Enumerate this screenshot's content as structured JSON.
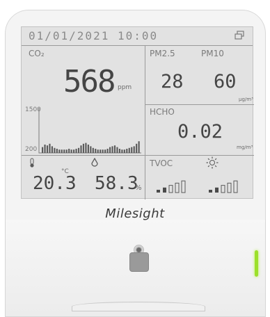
{
  "status_bar": {
    "datetime": "01/01/2021  10:00",
    "icon": "window-icon"
  },
  "co2": {
    "label": "CO₂",
    "value": "568",
    "unit": "ppm",
    "chart_max": "1500",
    "chart_min": "200",
    "history": [
      0.35,
      0.5,
      0.45,
      0.55,
      0.4,
      0.3,
      0.25,
      0.2,
      0.2,
      0.2,
      0.2,
      0.25,
      0.2,
      0.2,
      0.25,
      0.3,
      0.45,
      0.55,
      0.6,
      0.5,
      0.4,
      0.3,
      0.25,
      0.2,
      0.2,
      0.2,
      0.2,
      0.25,
      0.35,
      0.4,
      0.45,
      0.35,
      0.25,
      0.2,
      0.2,
      0.25,
      0.3,
      0.35,
      0.4,
      0.55,
      0.7
    ]
  },
  "pm25": {
    "label": "PM2.5",
    "value": "28"
  },
  "pm10": {
    "label": "PM10",
    "value": "60",
    "unit": "µg/m³"
  },
  "hcho": {
    "label": "HCHO",
    "value": "0.02",
    "unit": "mg/m³"
  },
  "temperature": {
    "icon": "thermometer-icon",
    "unit": "°C",
    "value": "20.3"
  },
  "humidity": {
    "icon": "droplet-icon",
    "unit": "%",
    "value": "58.3"
  },
  "tvoc": {
    "label": "TVOC",
    "level": 0.4
  },
  "light": {
    "icon": "sun-icon",
    "level": 0.4
  },
  "brand": {
    "logo": "Milesight"
  },
  "colors": {
    "led": "#9ce02a",
    "lcd_bg": "#e2e2e2"
  }
}
